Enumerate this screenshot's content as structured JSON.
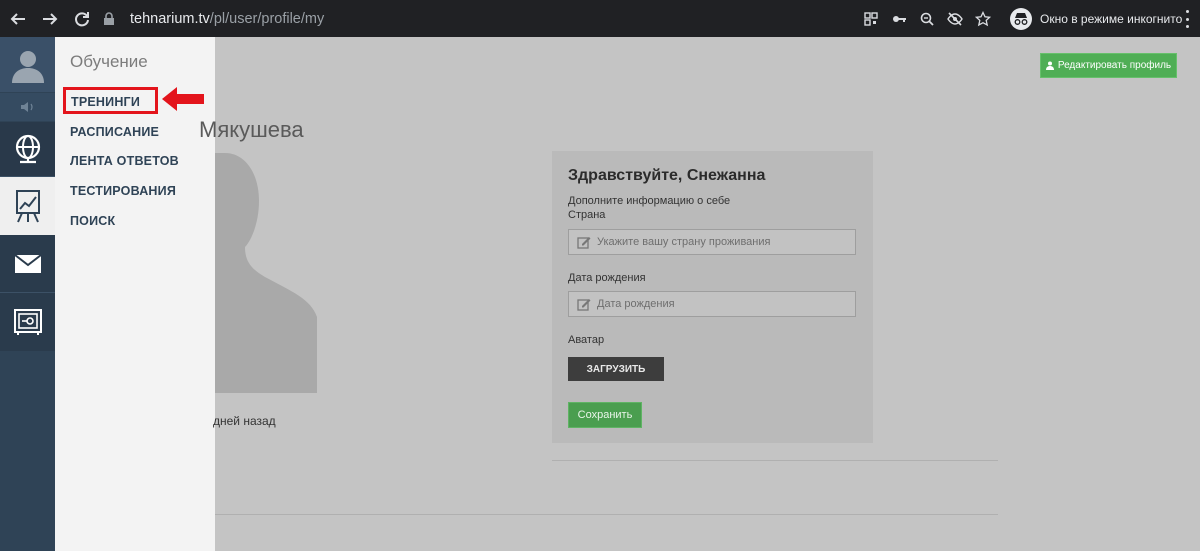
{
  "browser": {
    "url_host": "tehnarium.tv",
    "url_path": "/pl/user/profile/my",
    "incognito_label": "Окно в режиме инкогнито"
  },
  "iconbar": {
    "icons": [
      "avatar-icon",
      "sound-icon",
      "globe-icon",
      "chart-icon",
      "mail-icon",
      "safe-icon"
    ]
  },
  "flyout": {
    "title": "Обучение",
    "items": [
      "ТРЕНИНГИ",
      "РАСПИСАНИЕ",
      "ЛЕНТА ОТВЕТОВ",
      "ТЕСТИРОВАНИЯ",
      "ПОИСК"
    ]
  },
  "header": {
    "edit_profile_label": "Редактировать профиль"
  },
  "profile": {
    "name_fragment": "Мякушева",
    "last_seen": "дней назад"
  },
  "card": {
    "greeting": "Здравствуйте, Снежанна",
    "intro": "Дополните информацию о себе",
    "country_label": "Страна",
    "country_placeholder": "Укажите вашу страну проживания",
    "birthdate_label": "Дата рождения",
    "birthdate_placeholder": "Дата рождения",
    "avatar_label": "Аватар",
    "upload_label": "ЗАГРУЗИТЬ",
    "save_label": "Сохранить"
  },
  "colors": {
    "annotation": "#e3141b",
    "accent_green": "#4fae55",
    "sidebar": "#2f4356"
  }
}
